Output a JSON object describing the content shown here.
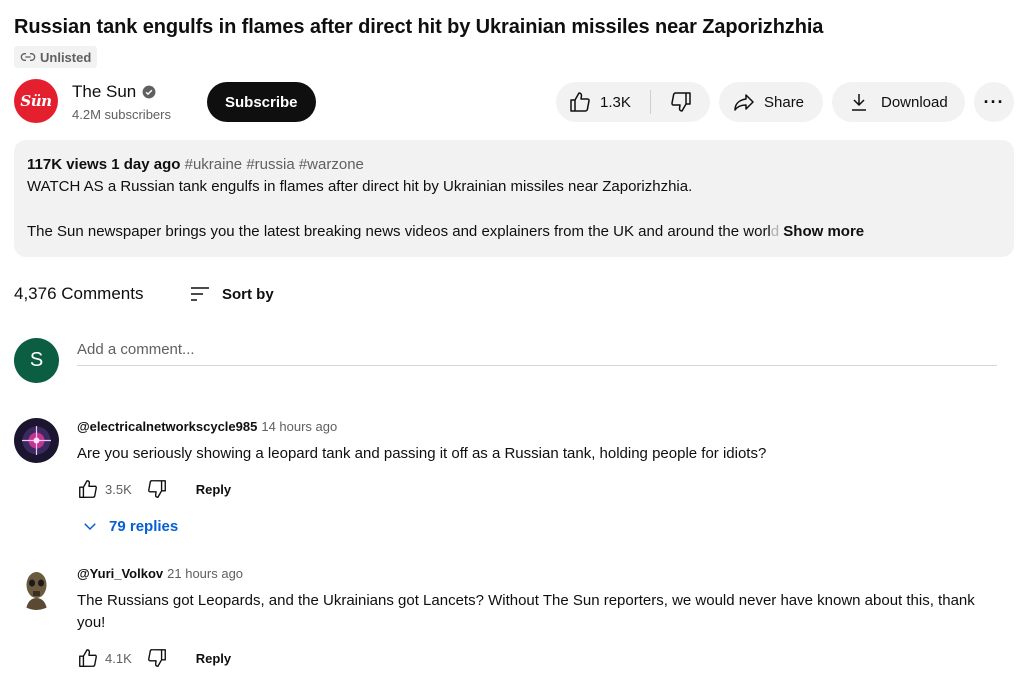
{
  "video": {
    "title": "Russian tank engulfs in flames after direct hit by Ukrainian missiles near Zaporizhzhia",
    "visibility": "Unlisted"
  },
  "channel": {
    "logo_text": "Sün",
    "name": "The Sun",
    "subscribers": "4.2M subscribers",
    "subscribe_label": "Subscribe"
  },
  "actions": {
    "likes": "1.3K",
    "share_label": "Share",
    "download_label": "Download",
    "more_label": "···"
  },
  "description": {
    "views": "117K views",
    "age": "1 day ago",
    "tags": "#ukraine #russia #warzone",
    "line1": "WATCH AS a Russian tank engulfs in flames after direct hit by Ukrainian missiles near Zaporizhzhia.",
    "line2_main": "The Sun newspaper brings you the latest breaking news videos and explainers from the UK and around the worl",
    "line2_fade": "d",
    "show_more": "Show more"
  },
  "comments_section": {
    "count": "4,376 Comments",
    "sort_label": "Sort by",
    "add_avatar_letter": "S",
    "add_placeholder": "Add a comment..."
  },
  "comments": [
    {
      "author": "@electricalnetworkscycle985",
      "time": "14 hours ago",
      "text": "Are you seriously showing a leopard tank and passing it off as a Russian tank, holding people for idiots?",
      "likes": "3.5K",
      "reply_label": "Reply",
      "replies": "79 replies"
    },
    {
      "author": "@Yuri_Volkov",
      "time": "21 hours ago",
      "text": "The Russians got Leopards, and the Ukrainians got Lancets? Without The Sun reporters, we would never have known about this, thank you!",
      "likes": "4.1K",
      "reply_label": "Reply"
    }
  ],
  "colors": {
    "brand_red": "#e4202e",
    "link_blue": "#065fd4",
    "avatar_green": "#0b5e42"
  }
}
